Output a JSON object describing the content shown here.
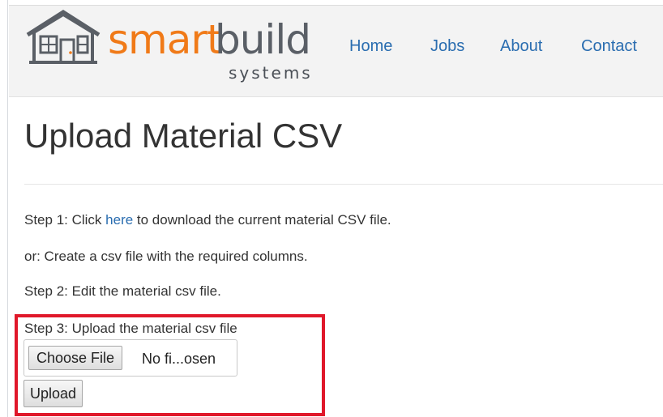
{
  "brand": {
    "word_smart": "smart",
    "word_build": "build",
    "word_systems": "systems",
    "colors": {
      "smart": "#f07a18",
      "build": "#5a5f66"
    }
  },
  "nav": {
    "home": "Home",
    "jobs": "Jobs",
    "about": "About",
    "contact": "Contact"
  },
  "main": {
    "title": "Upload Material CSV",
    "step1_prefix": "Step 1: Click ",
    "step1_link": "here",
    "step1_suffix": " to download the current material CSV file.",
    "step1_alt": "or: Create a csv file with the required columns.",
    "step2": "Step 2: Edit the material csv file.",
    "step3": "Step 3: Upload the material csv file",
    "choose_file_label": "Choose File",
    "file_status": "No fi...osen",
    "upload_label": "Upload"
  },
  "colors": {
    "link": "#2a6db0",
    "highlight_border": "#e0182a",
    "navbar_bg": "#f3f3f3"
  }
}
